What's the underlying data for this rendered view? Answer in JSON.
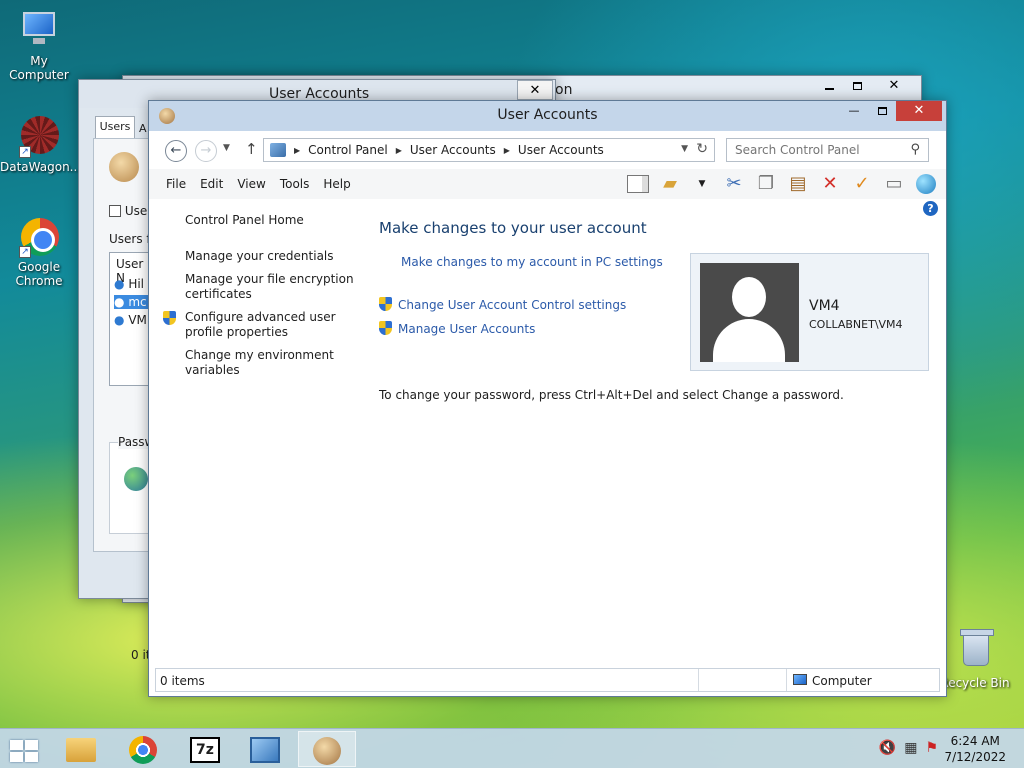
{
  "desktop": {
    "icons": [
      {
        "label": "My Computer",
        "icon": "computer-icon"
      },
      {
        "label": "DataWagon...",
        "icon": "datawagon-icon"
      },
      {
        "label": "Google Chrome",
        "icon": "chrome-icon"
      },
      {
        "label": "Recycle Bin",
        "icon": "recycle-bin-icon"
      }
    ]
  },
  "back_window": {
    "title": "User Accounts",
    "title_fragment": "on",
    "close_glyph": "✕",
    "tab": "Users",
    "tab2": "A",
    "check_label": "User",
    "users_label": "Users fo",
    "list_header": "User N",
    "list_items": [
      "Hil",
      "mc",
      "VM"
    ],
    "password_label": "Passw",
    "count_label": "0 it"
  },
  "main_window": {
    "title": "User Accounts",
    "min_glyph": "—",
    "close_glyph": "✕",
    "breadcrumb": [
      "Control Panel",
      "User Accounts",
      "User Accounts"
    ],
    "search_placeholder": "Search Control Panel",
    "menu": [
      "File",
      "Edit",
      "View",
      "Tools",
      "Help"
    ],
    "left_nav": {
      "home": "Control Panel Home",
      "items": [
        "Manage your credentials",
        "Manage your file encryption certificates",
        "Configure advanced user profile properties",
        "Change my environment variables"
      ]
    },
    "content": {
      "heading": "Make changes to your user account",
      "pc_settings_link": "Make changes to my account in PC settings",
      "uac_link": "Change User Account Control settings",
      "manage_link": "Manage User Accounts",
      "password_note": "To change your password, press Ctrl+Alt+Del and select Change a password."
    },
    "user_card": {
      "name": "VM4",
      "account": "COLLABNET\\VM4"
    },
    "status": {
      "items": "0 items",
      "location": "Computer"
    }
  },
  "taskbar": {
    "time": "6:24 AM",
    "date": "7/12/2022",
    "seven_zip_label": "7z"
  }
}
